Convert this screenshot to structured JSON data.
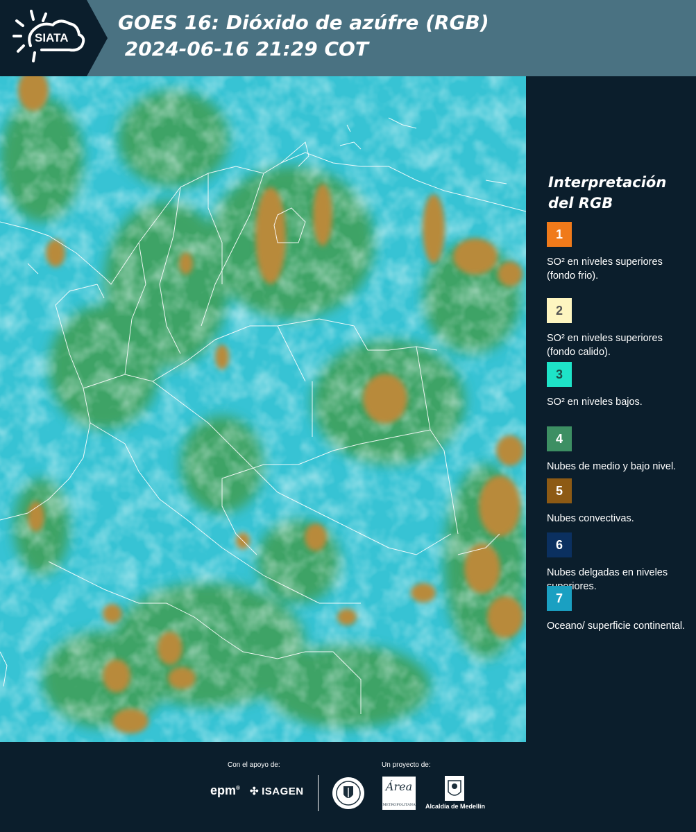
{
  "header": {
    "logo_text": "SIATA",
    "title_line1": "GOES 16: Dióxido de azúfre (RGB)",
    "title_line2": " 2024-06-16 21:29 COT"
  },
  "legend": {
    "title": "Interpretación del RGB",
    "items": [
      {
        "number": "1",
        "label": "SO² en niveles superiores (fondo frio).",
        "color": "#f07a1a",
        "text_color": "#ffffff"
      },
      {
        "number": "2",
        "label": "SO² en niveles superiores (fondo calido).",
        "color": "#fdf5c0",
        "text_color": "#555555"
      },
      {
        "number": "3",
        "label": "SO² en niveles bajos.",
        "color": "#1ee3c8",
        "text_color": "#1b4f4a"
      },
      {
        "number": "4",
        "label": "Nubes de medio y bajo nivel.",
        "color": "#3d8f63",
        "text_color": "#ffffff"
      },
      {
        "number": "5",
        "label": "Nubes convectivas.",
        "color": "#8d5a14",
        "text_color": "#ffffff"
      },
      {
        "number": "6",
        "label": "Nubes delgadas en niveles superiores.",
        "color": "#0b3060",
        "text_color": "#ffffff"
      },
      {
        "number": "7",
        "label": "Oceano/ superficie continental.",
        "color": "#1aa0c2",
        "text_color": "#ffffff"
      }
    ]
  },
  "footer": {
    "support_label": "Con el apoyo de:",
    "project_label": "Un proyecto de:",
    "epm": "epm",
    "isagen": "ISAGEN",
    "alcaldia": "Alcaldía de Medellín"
  },
  "colors": {
    "header_bg": "#4a7282",
    "logo_panel": "#0b1e2c",
    "background": "#0b1e2c",
    "map_base": "#39c6d6"
  }
}
